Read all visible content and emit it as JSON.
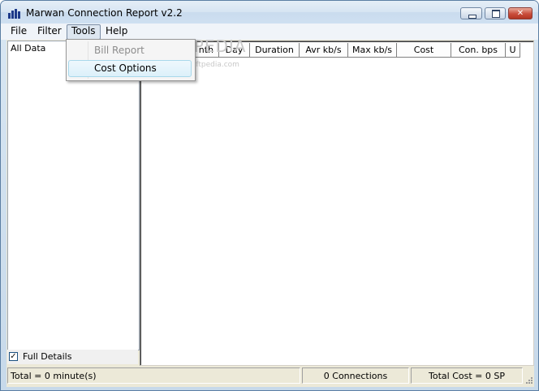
{
  "window": {
    "title": "Marwan Connection Report v2.2",
    "controls": {
      "minimize": "minimize-icon",
      "maximize": "maximize-icon",
      "close": "close-icon"
    }
  },
  "menu": {
    "items": [
      "File",
      "Filter",
      "Tools",
      "Help"
    ],
    "active": "Tools",
    "tools_dropdown": [
      {
        "label": "Bill Report",
        "enabled": false
      },
      {
        "label": "Cost Options",
        "enabled": true,
        "highlighted": true
      }
    ]
  },
  "tree": {
    "items": [
      "All Data"
    ]
  },
  "options": {
    "full_details_label": "Full Details",
    "full_details_checked": true
  },
  "table": {
    "columns": [
      "nth",
      "Day",
      "Duration",
      "Avr kb/s",
      "Max kb/s",
      "Cost",
      "Con. bps",
      "U"
    ],
    "rows": []
  },
  "status": {
    "total_time": "Total = 0 minute(s)",
    "connections": "0 Connections",
    "total_cost": "Total Cost = 0 SP"
  },
  "watermark": {
    "brand": "SOFTPEDIA",
    "url": "www.softpedia.com"
  },
  "colors": {
    "titlebar": "#d6e4f2",
    "close_button": "#c94d3b",
    "menu_hover": "#dcf0fa"
  }
}
